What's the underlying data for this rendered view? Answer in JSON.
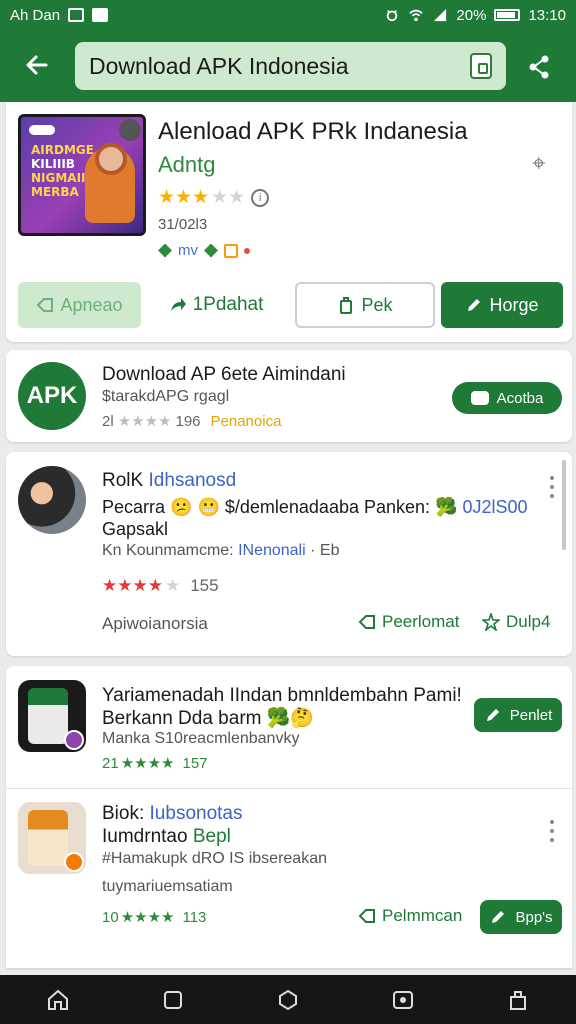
{
  "status_bar": {
    "carrier": "Ah Dan",
    "battery": "20%",
    "time": "13:10"
  },
  "app_bar": {
    "back_icon": "arrow-left-icon",
    "search_value": "Download APK Indonesia",
    "clipboard_icon": "clipboard-icon",
    "share_icon": "share-icon"
  },
  "hero": {
    "title": "Alenload APK PRk Indanesia",
    "developer": "Adntg",
    "stars": "★★★",
    "stars_off": "★★",
    "info_icon": "info-icon",
    "date": "31/02l3",
    "meta_text": "mv",
    "close_icon": "close-icon",
    "buttons": {
      "a": "Apneao",
      "b": "1Pdahat",
      "c": "Pek",
      "d": "Horge"
    },
    "thumb_lines": [
      "AIRDMGE",
      "KILIIIB",
      "NIGMAII",
      "MERBA"
    ]
  },
  "apk_card": {
    "logo_text": "APK",
    "title": "Download AP 6ete Aimindani",
    "subtitle": "$tarakdAPG rgagl",
    "rating_prefix": "2l",
    "stars": "★★★★",
    "count": "196",
    "label": "Penanoica",
    "button": "Acotba"
  },
  "post": {
    "name_a": "RolK ",
    "name_b": "Idhsanosd",
    "text_a": "Pecarra 😕 😬 ",
    "text_b": "$/demlenadaaba Panken: 🥦 ",
    "text_c": "0J2lS00",
    "text_d": "Gapsakl",
    "meta_a": "Kn Kounmamcme: ",
    "meta_b": "INenonali",
    "meta_c": " · Eb",
    "stars": "★★★★",
    "stars_off": "★",
    "count": "155",
    "footer": "Apiwoianorsia",
    "action_1": "Peerlomat",
    "action_2": "Dulp4"
  },
  "list": {
    "item1": {
      "title_a": "Yariamenadah IIndan bmnldembahn Pami!",
      "title_b": "Berkann Dda barm 🥦🤔",
      "subtitle": "Manka S10reacmlenbanvky",
      "rating_prefix": "21",
      "stars": "★★★★",
      "count": "157",
      "button": "Penlet"
    },
    "item2": {
      "title_a": "Biok: ",
      "title_b": "Iubsonotas",
      "title_c": "Iumdrntao ",
      "title_d": "Bepl",
      "subtitle": "#Hamakupk dRO IS ibsereakan",
      "subtitle2": "tuymariuemsatiam",
      "rating_prefix": "10",
      "stars": "★★★★",
      "count": "113",
      "action": "Pelmmcan",
      "button": "Bpp's"
    }
  },
  "nav_bar": {
    "icons": [
      "home-icon",
      "recents-icon",
      "circle-home-icon",
      "assistant-icon",
      "menu-icon"
    ]
  }
}
